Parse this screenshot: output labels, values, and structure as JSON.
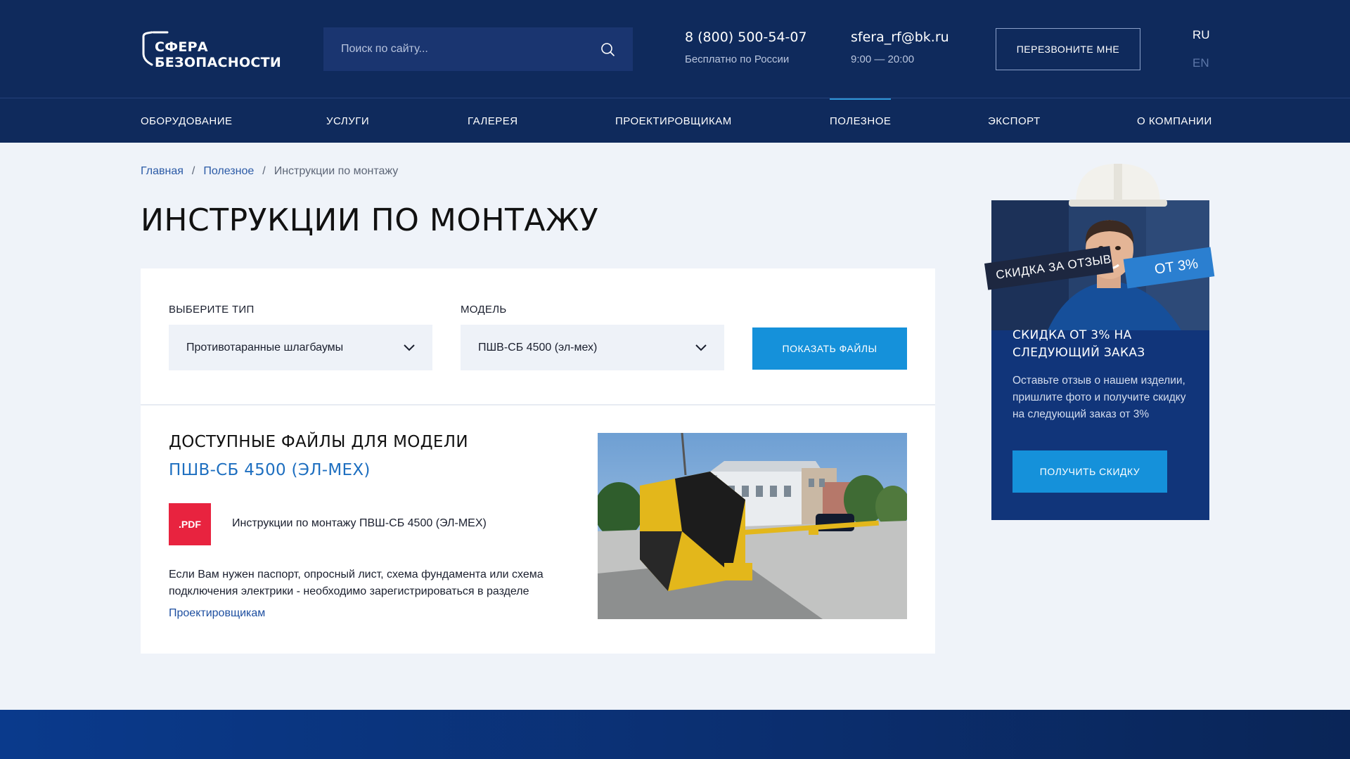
{
  "header": {
    "logo_line1": "СФЕРА",
    "logo_line2": "БЕЗОПАСНОСТИ",
    "search_placeholder": "Поиск по сайту...",
    "phone": "8 (800) 500-54-07",
    "phone_note": "Бесплатно по России",
    "email": "sfera_rf@bk.ru",
    "hours": "9:00 — 20:00",
    "callback_label": "ПЕРЕЗВОНИТЕ МНЕ",
    "lang_active": "RU",
    "lang_other": "EN"
  },
  "nav": {
    "items": [
      {
        "label": "ОБОРУДОВАНИЕ"
      },
      {
        "label": "УСЛУГИ"
      },
      {
        "label": "ГАЛЕРЕЯ"
      },
      {
        "label": "ПРОЕКТИРОВЩИКАМ"
      },
      {
        "label": "ПОЛЕЗНОЕ"
      },
      {
        "label": "ЭКСПОРТ"
      },
      {
        "label": "О КОМПАНИИ"
      }
    ],
    "active": "ПОЛЕЗНОЕ"
  },
  "breadcrumb": {
    "home": "Главная",
    "section": "Полезное",
    "current": "Инструкции по монтажу",
    "separator": "/"
  },
  "page": {
    "title": "ИНСТРУКЦИИ ПО МОНТАЖУ"
  },
  "filter": {
    "type_label": "ВЫБЕРИТЕ ТИП",
    "type_value": "Противотаранные шлагбаумы",
    "model_label": "МОДЕЛЬ",
    "model_value": "ПШВ-СБ 4500 (эл-мех)",
    "show_label": "ПОКАЗАТЬ ФАЙЛЫ"
  },
  "files": {
    "title": "ДОСТУПНЫЕ ФАЙЛЫ ДЛЯ МОДЕЛИ",
    "model": "ПШВ-СБ 4500 (ЭЛ-МЕХ)",
    "pdf_badge": ".PDF",
    "pdf_name": "Инструкции по монтажу ПВШ-СБ 4500 (ЭЛ-МЕХ)",
    "note": "Если Вам нужен паспорт, опросный лист, схема фундамента или схема подключения электрики - необходимо зарегистрироваться в разделе",
    "note_link": "Проектировщикам"
  },
  "promo": {
    "ribbon_text": "СКИДКА ЗА ОТЗЫВ",
    "ribbon_value": "ОТ 3%",
    "title": "СКИДКА ОТ 3% НА СЛЕДУЮЩИЙ ЗАКАЗ",
    "text": "Оставьте отзыв о нашем изделии, пришлите фото и получите скидку  на следующий заказ от 3%",
    "button": "ПОЛУЧИТЬ СКИДКУ"
  },
  "colors": {
    "header_bg": "#0f2a5c",
    "accent": "#1591da",
    "pdf_red": "#e8233f",
    "model_blue": "#1e6fc0"
  }
}
